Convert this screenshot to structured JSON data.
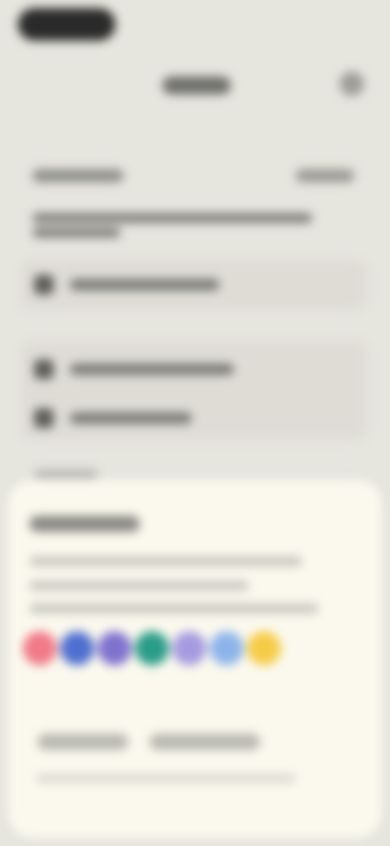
{
  "app": {
    "title": ""
  },
  "header": {
    "title": "",
    "icon": "settings-icon"
  },
  "section": {
    "label": "",
    "action": ""
  },
  "description_lines": 2,
  "rows": [
    {
      "label": "",
      "icon": "lock-icon"
    },
    {
      "label": "",
      "icon": "link-icon"
    },
    {
      "label": "",
      "icon": "copy-icon"
    }
  ],
  "sheet": {
    "title": "",
    "body": "",
    "swatches": [
      {
        "name": "red",
        "color": "#f07a88"
      },
      {
        "name": "blue",
        "color": "#4f6fd0"
      },
      {
        "name": "violet",
        "color": "#7f72cf"
      },
      {
        "name": "teal",
        "color": "#2a9c88"
      },
      {
        "name": "lavender",
        "color": "#a59ae0"
      },
      {
        "name": "light-blue",
        "color": "#8db4ea"
      },
      {
        "name": "yellow",
        "color": "#f5cc48"
      }
    ],
    "button_cancel": "",
    "button_confirm": ""
  }
}
